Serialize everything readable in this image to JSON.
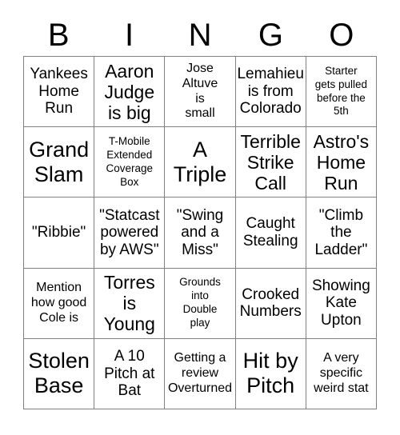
{
  "card": {
    "title": "BINGO",
    "header_letters": [
      "B",
      "I",
      "N",
      "G",
      "O"
    ],
    "rows": [
      [
        {
          "text": "Yankees\nHome\nRun",
          "size": "md"
        },
        {
          "text": "Aaron\nJudge\nis big",
          "size": "lg"
        },
        {
          "text": "Jose\nAltuve\nis\nsmall",
          "size": "sm"
        },
        {
          "text": "Lemahieu\nis from\nColorado",
          "size": "md"
        },
        {
          "text": "Starter\ngets pulled\nbefore the\n5th",
          "size": "xs"
        }
      ],
      [
        {
          "text": "Grand\nSlam",
          "size": "xl"
        },
        {
          "text": "T-Mobile\nExtended\nCoverage\nBox",
          "size": "xs"
        },
        {
          "text": "A\nTriple",
          "size": "xl"
        },
        {
          "text": "Terrible\nStrike\nCall",
          "size": "lg"
        },
        {
          "text": "Astro's\nHome\nRun",
          "size": "lg"
        }
      ],
      [
        {
          "text": "\"Ribbie\"",
          "size": "md"
        },
        {
          "text": "\"Statcast\npowered\nby AWS\"",
          "size": "md"
        },
        {
          "text": "\"Swing\nand a\nMiss\"",
          "size": "md"
        },
        {
          "text": "Caught\nStealing",
          "size": "md"
        },
        {
          "text": "\"Climb\nthe\nLadder\"",
          "size": "md"
        }
      ],
      [
        {
          "text": "Mention\nhow good\nCole is",
          "size": "sm"
        },
        {
          "text": "Torres\nis\nYoung",
          "size": "lg"
        },
        {
          "text": "Grounds\ninto\nDouble\nplay",
          "size": "xs"
        },
        {
          "text": "Crooked\nNumbers",
          "size": "md"
        },
        {
          "text": "Showing\nKate\nUpton",
          "size": "md"
        }
      ],
      [
        {
          "text": "Stolen\nBase",
          "size": "xl"
        },
        {
          "text": "A 10\nPitch at\nBat",
          "size": "md"
        },
        {
          "text": "Getting a\nreview\nOverturned",
          "size": "sm"
        },
        {
          "text": "Hit by\nPitch",
          "size": "xl"
        },
        {
          "text": "A very\nspecific\nweird stat",
          "size": "sm"
        }
      ]
    ]
  }
}
